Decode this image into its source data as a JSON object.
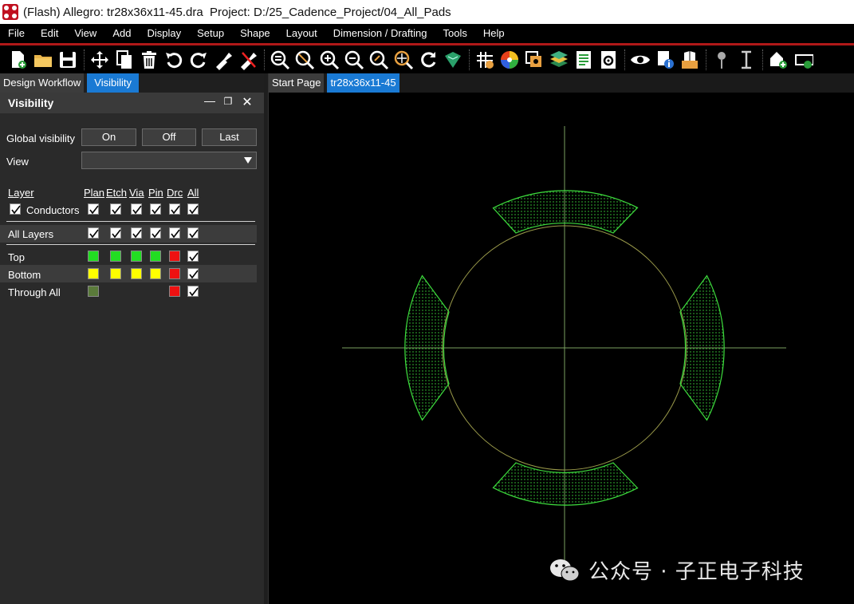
{
  "window": {
    "title": "(Flash) Allegro: tr28x36x11-45.dra  Project: D:/25_Cadence_Project/04_All_Pads"
  },
  "menu": [
    "File",
    "Edit",
    "View",
    "Add",
    "Display",
    "Setup",
    "Shape",
    "Layout",
    "Dimension / Drafting",
    "Tools",
    "Help"
  ],
  "toolbar": {
    "icons": [
      "new-file-icon",
      "open-folder-icon",
      "save-icon",
      "move-icon",
      "copy-icon",
      "delete-icon",
      "undo-icon",
      "redo-icon",
      "pin-icon",
      "unpin-icon",
      "zoom-fit-icon",
      "zoom-window-icon",
      "zoom-in-icon",
      "zoom-out-icon",
      "zoom-previous-icon",
      "zoom-center-icon",
      "redraw-icon",
      "board-3d-icon",
      "grid-icon",
      "color-wheel-icon",
      "shadow-mode-icon",
      "layers-icon",
      "report-icon",
      "settings-doc-icon",
      "visibility-eye-icon",
      "info-icon",
      "package-3d-icon",
      "pushpin-icon",
      "text-cursor-icon",
      "add-shape-icon",
      "more-icon"
    ]
  },
  "left_panel": {
    "tabs": [
      "Design Workflow",
      "Visibility"
    ],
    "active_tab": "Visibility",
    "header": "Visibility",
    "global_visibility_label": "Global visibility",
    "buttons": {
      "on": "On",
      "off": "Off",
      "last": "Last"
    },
    "view_label": "View",
    "view_value": "",
    "columns": {
      "layer": "Layer",
      "plan": "Plan",
      "etch": "Etch",
      "via": "Via",
      "pin": "Pin",
      "drc": "Drc",
      "all": "All"
    },
    "conductors_label": "Conductors",
    "all_layers_label": "All Layers",
    "layers": [
      {
        "name": "Top",
        "colors": [
          "#22dd22",
          "#22dd22",
          "#22dd22",
          "#22dd22",
          "#ee1111"
        ],
        "all": true
      },
      {
        "name": "Bottom",
        "colors": [
          "#ffff00",
          "#ffff00",
          "#ffff00",
          "#ffff00",
          "#ee1111"
        ],
        "all": true
      },
      {
        "name": "Through All",
        "colors": [
          "#5a7a3a",
          "",
          "",
          "",
          "#ee1111"
        ],
        "all": true
      }
    ]
  },
  "doc_tabs": [
    "Start Page",
    "tr28x36x11-45"
  ],
  "active_doc_tab": "tr28x36x11-45",
  "canvas": {
    "pad_color": "#3ddc3d",
    "circle_color": "#9a9a4a",
    "crosshair_color": "#7aa060"
  },
  "watermark": {
    "text": "公众号 · 子正电子科技"
  }
}
